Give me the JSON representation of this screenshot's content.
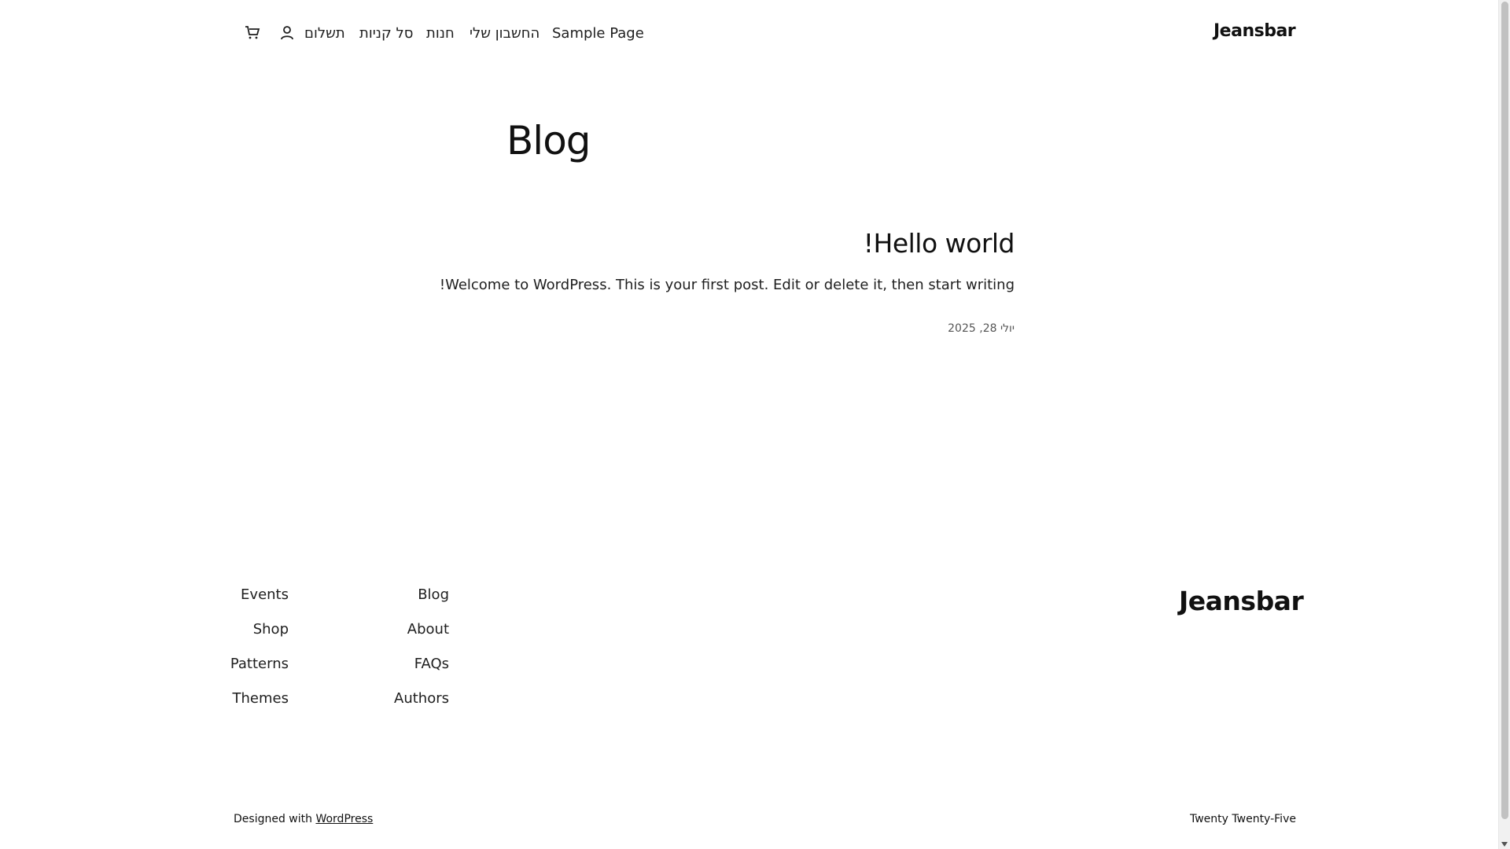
{
  "header": {
    "site_title": "Jeansbar",
    "nav": {
      "sample_page": "Sample Page",
      "my_account": "החשבון שלי",
      "shop": "חנות",
      "cart": "סל קניות",
      "checkout": "תשלום"
    },
    "icons": {
      "account": "user-icon",
      "cart": "shopping-cart-icon"
    }
  },
  "main": {
    "heading": "Blog",
    "posts": [
      {
        "title": "Hello world!",
        "excerpt": "Welcome to WordPress. This is your first post. Edit or delete it, then start writing!",
        "date": "יולי 28, 2025"
      }
    ]
  },
  "footer": {
    "site_title": "Jeansbar",
    "nav_col_1": [
      "Blog",
      "About",
      "FAQs",
      "Authors"
    ],
    "nav_col_2": [
      "Events",
      "Shop",
      "Patterns",
      "Themes"
    ],
    "credit_prefix": "Designed with",
    "credit_link": "WordPress",
    "theme_name": "Twenty Twenty-Five"
  }
}
